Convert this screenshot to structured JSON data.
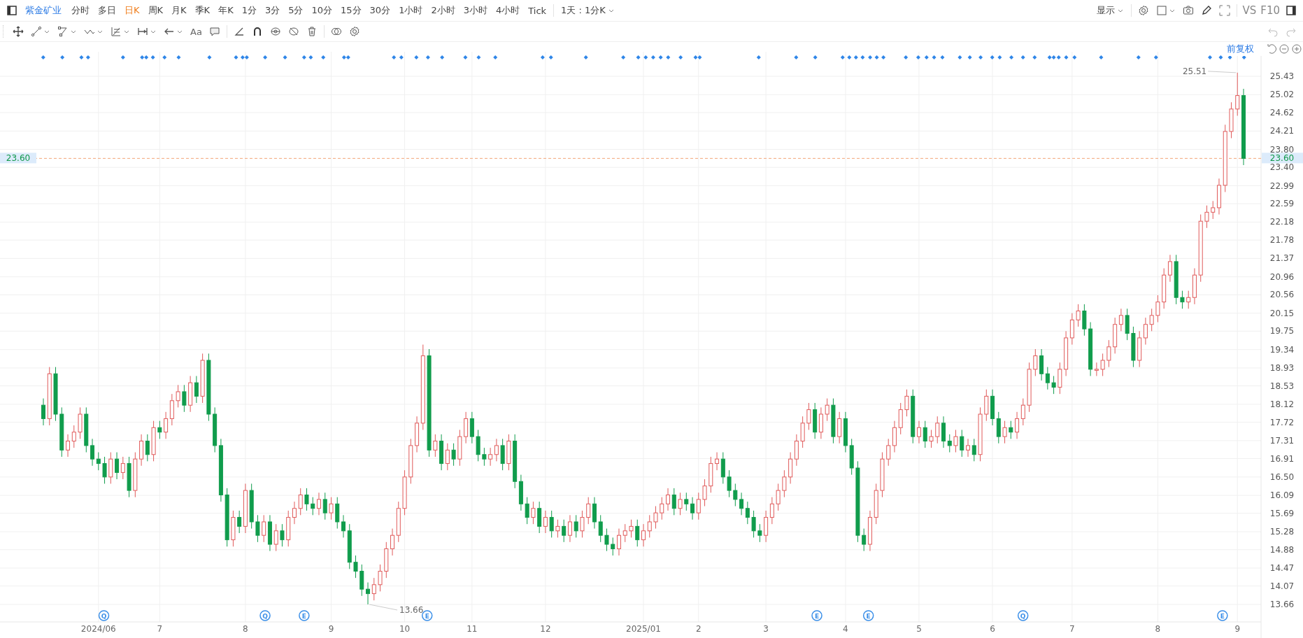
{
  "toolbar": {
    "symbol": "紫金矿业",
    "periods": [
      {
        "label": "分时",
        "selected": false
      },
      {
        "label": "多日",
        "selected": false
      },
      {
        "label": "日K",
        "selected": true
      },
      {
        "label": "周K",
        "selected": false
      },
      {
        "label": "月K",
        "selected": false
      },
      {
        "label": "季K",
        "selected": false
      },
      {
        "label": "年K",
        "selected": false
      },
      {
        "label": "1分",
        "selected": false
      },
      {
        "label": "3分",
        "selected": false
      },
      {
        "label": "5分",
        "selected": false
      },
      {
        "label": "10分",
        "selected": false
      },
      {
        "label": "15分",
        "selected": false
      },
      {
        "label": "30分",
        "selected": false
      },
      {
        "label": "1小时",
        "selected": false
      },
      {
        "label": "2小时",
        "selected": false
      },
      {
        "label": "3小时",
        "selected": false
      },
      {
        "label": "4小时",
        "selected": false
      },
      {
        "label": "Tick",
        "selected": false
      }
    ],
    "interval_picker": "1天 : 1分K",
    "display_menu": "显示",
    "vs": "VS",
    "f10": "F10"
  },
  "drawing_toolbar": {
    "text_tool": "Aa"
  },
  "chart": {
    "adjustment": "前复权",
    "event_markers": [
      {
        "label": "Q"
      },
      {
        "label": "Q"
      },
      {
        "label": "E"
      },
      {
        "label": "E"
      },
      {
        "label": "E"
      },
      {
        "label": "E"
      },
      {
        "label": "Q"
      },
      {
        "label": "E"
      }
    ],
    "chart_data": {
      "type": "candlestick",
      "grid": true,
      "ylim": [
        13.66,
        25.43
      ],
      "yticks": [
        25.43,
        25.02,
        24.62,
        24.21,
        {
          "value": 23.8,
          "label": "23.80"
        },
        {
          "value": 23.4,
          "label": "23.40"
        },
        22.99,
        22.59,
        22.18,
        21.78,
        21.37,
        20.96,
        20.56,
        20.15,
        19.75,
        19.34,
        18.93,
        18.53,
        18.12,
        17.72,
        17.31,
        16.91,
        {
          "value": 16.5,
          "label": "16.50"
        },
        16.09,
        15.69,
        15.28,
        14.88,
        14.47,
        14.07,
        13.66
      ],
      "categories": [
        null,
        null,
        null,
        null,
        null,
        null,
        null,
        null,
        null,
        "2024/06",
        null,
        null,
        null,
        null,
        null,
        null,
        null,
        null,
        null,
        "7",
        null,
        null,
        null,
        null,
        null,
        null,
        null,
        null,
        null,
        null,
        null,
        null,
        null,
        "8",
        null,
        null,
        null,
        null,
        null,
        null,
        null,
        null,
        null,
        null,
        null,
        null,
        null,
        "9",
        null,
        null,
        null,
        null,
        null,
        null,
        null,
        null,
        null,
        null,
        null,
        "10",
        null,
        null,
        null,
        null,
        null,
        null,
        null,
        null,
        null,
        null,
        "11",
        null,
        null,
        null,
        null,
        null,
        null,
        null,
        null,
        null,
        null,
        null,
        "12",
        null,
        null,
        null,
        null,
        null,
        null,
        null,
        null,
        null,
        null,
        null,
        null,
        null,
        null,
        null,
        "2025/01",
        null,
        null,
        null,
        null,
        null,
        null,
        null,
        null,
        "2",
        null,
        null,
        null,
        null,
        null,
        null,
        null,
        null,
        null,
        null,
        "3",
        null,
        null,
        null,
        null,
        null,
        null,
        null,
        null,
        null,
        null,
        null,
        null,
        "4",
        null,
        null,
        null,
        null,
        null,
        null,
        null,
        null,
        null,
        null,
        null,
        "5",
        null,
        null,
        null,
        null,
        null,
        null,
        null,
        null,
        null,
        null,
        null,
        "6",
        null,
        null,
        null,
        null,
        null,
        null,
        null,
        null,
        null,
        null,
        null,
        null,
        "7",
        null,
        null,
        null,
        null,
        null,
        null,
        null,
        null,
        null,
        null,
        null,
        null,
        null,
        "8",
        null,
        null,
        null,
        null,
        null,
        null,
        null,
        null,
        null,
        null,
        null,
        null,
        "9",
        null
      ],
      "ohlc": [
        [
          18.1,
          18.25,
          17.65,
          17.8
        ],
        [
          17.8,
          18.95,
          17.65,
          18.8
        ],
        [
          18.8,
          18.95,
          17.75,
          17.9
        ],
        [
          17.9,
          18.05,
          16.95,
          17.1
        ],
        [
          17.1,
          17.45,
          16.95,
          17.3
        ],
        [
          17.3,
          17.65,
          17.15,
          17.5
        ],
        [
          17.5,
          18.05,
          17.35,
          17.9
        ],
        [
          17.9,
          18.05,
          17.05,
          17.2
        ],
        [
          17.2,
          17.35,
          16.75,
          16.9
        ],
        [
          16.9,
          17.05,
          16.65,
          16.8
        ],
        [
          16.8,
          16.95,
          16.35,
          16.5
        ],
        [
          16.5,
          17.05,
          16.35,
          16.9
        ],
        [
          16.9,
          17.05,
          16.45,
          16.6
        ],
        [
          16.6,
          16.95,
          16.45,
          16.8
        ],
        [
          16.8,
          16.95,
          16.05,
          16.2
        ],
        [
          16.2,
          17.05,
          16.05,
          16.9
        ],
        [
          16.9,
          17.45,
          16.75,
          17.3
        ],
        [
          17.3,
          17.45,
          16.85,
          17.0
        ],
        [
          17.0,
          17.75,
          16.85,
          17.6
        ],
        [
          17.6,
          17.75,
          17.35,
          17.5
        ],
        [
          17.5,
          17.95,
          17.35,
          17.8
        ],
        [
          17.8,
          18.35,
          17.65,
          18.2
        ],
        [
          18.2,
          18.55,
          18.05,
          18.4
        ],
        [
          18.4,
          18.55,
          17.95,
          18.1
        ],
        [
          18.1,
          18.75,
          17.95,
          18.6
        ],
        [
          18.6,
          18.75,
          18.15,
          18.3
        ],
        [
          18.3,
          19.25,
          18.15,
          19.1
        ],
        [
          19.1,
          19.25,
          17.75,
          17.9
        ],
        [
          17.9,
          18.05,
          17.05,
          17.2
        ],
        [
          17.2,
          17.35,
          15.95,
          16.1
        ],
        [
          16.1,
          16.25,
          14.95,
          15.1
        ],
        [
          15.1,
          15.75,
          14.95,
          15.6
        ],
        [
          15.6,
          15.75,
          15.25,
          15.4
        ],
        [
          15.4,
          16.35,
          15.25,
          16.2
        ],
        [
          16.2,
          16.35,
          15.35,
          15.5
        ],
        [
          15.5,
          15.65,
          15.05,
          15.2
        ],
        [
          15.2,
          15.65,
          15.05,
          15.5
        ],
        [
          15.5,
          15.65,
          14.85,
          15.0
        ],
        [
          15.0,
          15.45,
          14.85,
          15.3
        ],
        [
          15.3,
          15.45,
          14.95,
          15.1
        ],
        [
          15.1,
          15.75,
          14.95,
          15.6
        ],
        [
          15.6,
          15.95,
          15.45,
          15.8
        ],
        [
          15.8,
          16.25,
          15.65,
          16.1
        ],
        [
          16.1,
          16.25,
          15.75,
          15.9
        ],
        [
          15.9,
          16.05,
          15.65,
          15.8
        ],
        [
          15.8,
          16.15,
          15.65,
          16.0
        ],
        [
          16.0,
          16.15,
          15.55,
          15.7
        ],
        [
          15.7,
          16.05,
          15.55,
          15.9
        ],
        [
          15.9,
          16.05,
          15.35,
          15.5
        ],
        [
          15.5,
          15.65,
          15.15,
          15.3
        ],
        [
          15.3,
          15.45,
          14.45,
          14.6
        ],
        [
          14.6,
          14.75,
          14.25,
          14.4
        ],
        [
          14.4,
          14.55,
          13.85,
          14.0
        ],
        [
          14.0,
          14.15,
          13.66,
          13.9
        ],
        [
          13.9,
          14.25,
          13.75,
          14.1
        ],
        [
          14.1,
          14.55,
          13.95,
          14.4
        ],
        [
          14.4,
          15.05,
          14.25,
          14.9
        ],
        [
          14.9,
          15.35,
          14.75,
          15.2
        ],
        [
          15.2,
          15.95,
          15.05,
          15.8
        ],
        [
          15.8,
          16.65,
          15.65,
          16.5
        ],
        [
          16.5,
          17.35,
          16.35,
          17.2
        ],
        [
          17.2,
          17.85,
          17.05,
          17.7
        ],
        [
          17.7,
          19.45,
          17.55,
          19.2
        ],
        [
          19.2,
          19.35,
          16.95,
          17.1
        ],
        [
          17.1,
          17.45,
          16.95,
          17.3
        ],
        [
          17.3,
          17.45,
          16.65,
          16.8
        ],
        [
          16.8,
          17.25,
          16.65,
          17.1
        ],
        [
          17.1,
          17.25,
          16.75,
          16.9
        ],
        [
          16.9,
          17.55,
          16.75,
          17.4
        ],
        [
          17.4,
          17.95,
          17.25,
          17.8
        ],
        [
          17.8,
          17.95,
          17.25,
          17.4
        ],
        [
          17.4,
          17.55,
          16.85,
          17.0
        ],
        [
          17.0,
          17.15,
          16.75,
          16.9
        ],
        [
          16.9,
          17.15,
          16.75,
          17.0
        ],
        [
          17.0,
          17.35,
          16.85,
          17.2
        ],
        [
          17.2,
          17.35,
          16.65,
          16.8
        ],
        [
          16.8,
          17.45,
          16.65,
          17.3
        ],
        [
          17.3,
          17.45,
          16.25,
          16.4
        ],
        [
          16.4,
          16.55,
          15.75,
          15.9
        ],
        [
          15.9,
          16.05,
          15.45,
          15.6
        ],
        [
          15.6,
          15.95,
          15.45,
          15.8
        ],
        [
          15.8,
          15.95,
          15.25,
          15.4
        ],
        [
          15.4,
          15.75,
          15.25,
          15.6
        ],
        [
          15.6,
          15.75,
          15.15,
          15.3
        ],
        [
          15.3,
          15.55,
          15.15,
          15.4
        ],
        [
          15.4,
          15.55,
          15.05,
          15.2
        ],
        [
          15.2,
          15.65,
          15.05,
          15.5
        ],
        [
          15.5,
          15.65,
          15.15,
          15.3
        ],
        [
          15.3,
          15.75,
          15.15,
          15.6
        ],
        [
          15.6,
          16.05,
          15.45,
          15.9
        ],
        [
          15.9,
          16.05,
          15.35,
          15.5
        ],
        [
          15.5,
          15.65,
          15.05,
          15.2
        ],
        [
          15.2,
          15.35,
          14.85,
          15.0
        ],
        [
          15.0,
          15.15,
          14.75,
          14.9
        ],
        [
          14.9,
          15.35,
          14.75,
          15.2
        ],
        [
          15.2,
          15.45,
          15.05,
          15.3
        ],
        [
          15.3,
          15.55,
          15.15,
          15.4
        ],
        [
          15.4,
          15.55,
          14.95,
          15.1
        ],
        [
          15.1,
          15.45,
          14.95,
          15.3
        ],
        [
          15.3,
          15.65,
          15.15,
          15.5
        ],
        [
          15.5,
          15.85,
          15.35,
          15.7
        ],
        [
          15.7,
          16.05,
          15.55,
          15.9
        ],
        [
          15.9,
          16.25,
          15.75,
          16.1
        ],
        [
          16.1,
          16.25,
          15.65,
          15.8
        ],
        [
          15.8,
          16.15,
          15.65,
          16.0
        ],
        [
          16.0,
          16.15,
          15.75,
          15.9
        ],
        [
          15.9,
          16.05,
          15.55,
          15.7
        ],
        [
          15.7,
          16.15,
          15.55,
          16.0
        ],
        [
          16.0,
          16.45,
          15.85,
          16.3
        ],
        [
          16.3,
          16.95,
          16.15,
          16.8
        ],
        [
          16.8,
          17.05,
          16.65,
          16.9
        ],
        [
          16.9,
          17.05,
          16.35,
          16.5
        ],
        [
          16.5,
          16.65,
          16.05,
          16.2
        ],
        [
          16.2,
          16.35,
          15.85,
          16.0
        ],
        [
          16.0,
          16.15,
          15.65,
          15.8
        ],
        [
          15.8,
          15.95,
          15.45,
          15.6
        ],
        [
          15.6,
          15.75,
          15.15,
          15.3
        ],
        [
          15.3,
          15.45,
          15.05,
          15.2
        ],
        [
          15.2,
          15.75,
          15.05,
          15.6
        ],
        [
          15.6,
          16.05,
          15.45,
          15.9
        ],
        [
          15.9,
          16.35,
          15.75,
          16.2
        ],
        [
          16.2,
          16.65,
          16.05,
          16.5
        ],
        [
          16.5,
          17.05,
          16.35,
          16.9
        ],
        [
          16.9,
          17.45,
          16.75,
          17.3
        ],
        [
          17.3,
          17.85,
          17.15,
          17.7
        ],
        [
          17.7,
          18.15,
          17.55,
          18.0
        ],
        [
          18.0,
          18.15,
          17.35,
          17.5
        ],
        [
          17.5,
          18.05,
          17.35,
          17.9
        ],
        [
          17.9,
          18.25,
          17.75,
          18.1
        ],
        [
          18.1,
          18.25,
          17.25,
          17.4
        ],
        [
          17.4,
          17.95,
          17.25,
          17.8
        ],
        [
          17.8,
          17.95,
          17.05,
          17.2
        ],
        [
          17.2,
          17.35,
          16.55,
          16.7
        ],
        [
          16.7,
          16.85,
          15.05,
          15.2
        ],
        [
          15.2,
          15.35,
          14.85,
          15.0
        ],
        [
          15.0,
          15.75,
          14.85,
          15.6
        ],
        [
          15.6,
          16.35,
          15.45,
          16.2
        ],
        [
          16.2,
          17.05,
          16.05,
          16.9
        ],
        [
          16.9,
          17.35,
          16.75,
          17.2
        ],
        [
          17.2,
          17.75,
          17.05,
          17.6
        ],
        [
          17.6,
          18.15,
          17.45,
          18.0
        ],
        [
          18.0,
          18.45,
          17.85,
          18.3
        ],
        [
          18.3,
          18.45,
          17.25,
          17.4
        ],
        [
          17.4,
          17.75,
          17.25,
          17.6
        ],
        [
          17.6,
          17.75,
          17.15,
          17.3
        ],
        [
          17.3,
          17.55,
          17.15,
          17.4
        ],
        [
          17.4,
          17.85,
          17.25,
          17.7
        ],
        [
          17.7,
          17.85,
          17.15,
          17.3
        ],
        [
          17.3,
          17.45,
          17.05,
          17.2
        ],
        [
          17.2,
          17.55,
          17.05,
          17.4
        ],
        [
          17.4,
          17.55,
          16.95,
          17.1
        ],
        [
          17.1,
          17.35,
          16.95,
          17.2
        ],
        [
          17.2,
          17.35,
          16.85,
          17.0
        ],
        [
          17.0,
          18.05,
          16.85,
          17.9
        ],
        [
          17.9,
          18.45,
          17.75,
          18.3
        ],
        [
          18.3,
          18.45,
          17.65,
          17.8
        ],
        [
          17.8,
          17.95,
          17.25,
          17.4
        ],
        [
          17.4,
          17.75,
          17.25,
          17.6
        ],
        [
          17.6,
          17.75,
          17.35,
          17.5
        ],
        [
          17.5,
          17.95,
          17.35,
          17.8
        ],
        [
          17.8,
          18.25,
          17.65,
          18.1
        ],
        [
          18.1,
          19.05,
          17.95,
          18.9
        ],
        [
          18.9,
          19.35,
          18.75,
          19.2
        ],
        [
          19.2,
          19.35,
          18.65,
          18.8
        ],
        [
          18.8,
          18.95,
          18.45,
          18.6
        ],
        [
          18.6,
          18.75,
          18.35,
          18.5
        ],
        [
          18.5,
          19.05,
          18.35,
          18.9
        ],
        [
          18.9,
          19.75,
          18.75,
          19.6
        ],
        [
          19.6,
          20.15,
          19.45,
          20.0
        ],
        [
          20.0,
          20.35,
          19.85,
          20.2
        ],
        [
          20.2,
          20.35,
          19.65,
          19.8
        ],
        [
          19.8,
          19.95,
          18.75,
          18.9
        ],
        [
          18.9,
          19.05,
          18.75,
          18.9
        ],
        [
          18.9,
          19.25,
          18.75,
          19.1
        ],
        [
          19.1,
          19.55,
          18.95,
          19.4
        ],
        [
          19.4,
          20.05,
          19.25,
          19.9
        ],
        [
          19.9,
          20.25,
          19.75,
          20.1
        ],
        [
          20.1,
          20.25,
          19.55,
          19.7
        ],
        [
          19.7,
          19.85,
          18.95,
          19.1
        ],
        [
          19.1,
          19.75,
          18.95,
          19.6
        ],
        [
          19.6,
          20.05,
          19.45,
          19.9
        ],
        [
          19.9,
          20.25,
          19.75,
          20.1
        ],
        [
          20.1,
          20.55,
          19.95,
          20.4
        ],
        [
          20.4,
          21.15,
          20.25,
          21.0
        ],
        [
          21.0,
          21.45,
          20.85,
          21.3
        ],
        [
          21.3,
          21.45,
          20.35,
          20.5
        ],
        [
          20.5,
          20.65,
          20.25,
          20.4
        ],
        [
          20.4,
          20.65,
          20.25,
          20.5
        ],
        [
          20.5,
          21.15,
          20.35,
          21.0
        ],
        [
          21.0,
          22.35,
          20.85,
          22.2
        ],
        [
          22.2,
          22.55,
          22.05,
          22.4
        ],
        [
          22.4,
          22.65,
          22.25,
          22.5
        ],
        [
          22.5,
          23.15,
          22.35,
          23.0
        ],
        [
          23.0,
          24.35,
          22.85,
          24.2
        ],
        [
          24.2,
          24.85,
          24.05,
          24.7
        ],
        [
          24.7,
          25.51,
          24.55,
          25.0
        ],
        [
          25.0,
          25.15,
          23.45,
          23.6
        ]
      ],
      "ref_lines": [
        {
          "axis": "y",
          "value": 23.6,
          "label": "23.60",
          "color": "#f3a77a"
        }
      ],
      "annotations": [
        "25.51",
        "13.66",
        "23.60"
      ]
    }
  }
}
